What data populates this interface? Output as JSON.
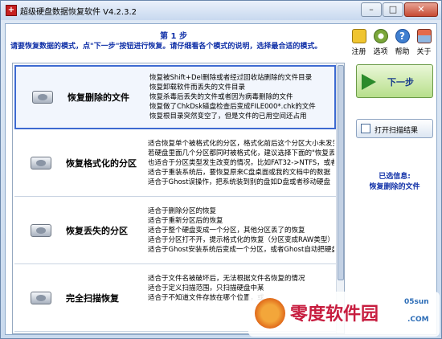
{
  "window": {
    "title": "超级硬盘数据恢复软件 V4.2.3.2",
    "controls": [
      "–",
      "□",
      "✕"
    ]
  },
  "header": {
    "step_title": "第 1 步",
    "step_desc": "请要恢复数据的模式，点\"下一步\"按钮进行恢复。请仔细看各个模式的说明，选择最合适的模式。"
  },
  "toolbar": {
    "items": [
      {
        "label": "注册",
        "icon": "register-icon"
      },
      {
        "label": "选项",
        "icon": "options-icon"
      },
      {
        "label": "帮助",
        "icon": "help-icon"
      },
      {
        "label": "关于",
        "icon": "about-icon"
      }
    ]
  },
  "modes": [
    {
      "name": "恢复删除的文件",
      "selected": true,
      "lines": [
        "恢复被Shift+Del删除或者经过回收站删除的文件目录",
        "恢复卸载软件而丢失的文件目录",
        "恢复杀毒后丢失的文件或者因为病毒删除的文件",
        "恢复做了ChkDsk磁盘检查后变成FILE000*.chk的文件",
        "恢复根目录突然变空了，但是文件的已用空间还占用"
      ]
    },
    {
      "name": "恢复格式化的分区",
      "selected": false,
      "lines": [
        "适合恢复单个被格式化的分区，格式化前后这个分区大小未发生",
        "若硬盘里面几个分区都同时被格式化，建议选择下面的\"恢复丢失的",
        "也适合于分区类型发生改变的情况，比如FAT32->NTFS，或者NT",
        "适合于重装系统后，要恢复原来C盘桌面或我的文档中的数据",
        "适合于Ghost误操作，把系统装到别的盘如D盘或者移动硬盘"
      ]
    },
    {
      "name": "恢复丢失的分区",
      "selected": false,
      "lines": [
        "适合于删除分区的恢复",
        "适合于重新分区后的恢复",
        "适合于整个硬盘变成一个分区，其他分区丢了的恢复",
        "适合于分区打不开，提示格式化的恢复（分区变成RAW类型）",
        "适合于Ghost安装系统后变成一个分区，或者Ghost自动把硬盘分"
      ]
    },
    {
      "name": "完全扫描恢复",
      "selected": false,
      "lines": [
        "适合于文件名被破坏后，无法根据文件名恢复的情况",
        "适合于定义扫描范围，只扫描硬盘中某",
        "适合于不知道文件存放在哪个位置，或"
      ]
    }
  ],
  "actions": {
    "next_label": "下一步",
    "scan_label": "打开扫描结果"
  },
  "selected_info": {
    "title": "已选信息:",
    "value": "恢复删除的文件"
  },
  "watermark": {
    "text": "零度软件园",
    "sub1": "05sun",
    "sub2": ".COM"
  }
}
